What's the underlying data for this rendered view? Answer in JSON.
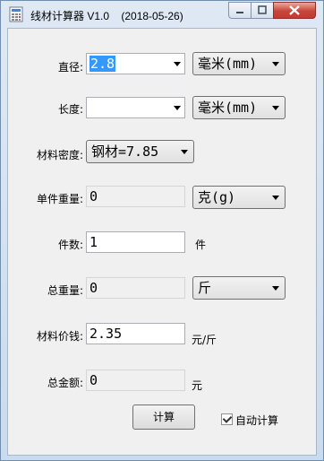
{
  "window": {
    "title": "线材计算器 V1.0    (2018-05-26)"
  },
  "form": {
    "diameter": {
      "label": "直径:",
      "value": "2.8",
      "unit": "毫米(mm)"
    },
    "length": {
      "label": "长度:",
      "value": "",
      "unit": "毫米(mm)"
    },
    "density": {
      "label": "材料密度:",
      "value": "钢材=7.85"
    },
    "unit_weight": {
      "label": "单件重量:",
      "value": "0",
      "unit": "克(g)"
    },
    "count": {
      "label": "件数:",
      "value": "1",
      "unit": "件"
    },
    "total_weight": {
      "label": "总重量:",
      "value": "0",
      "unit": "斤"
    },
    "price": {
      "label": "材料价钱:",
      "value": "2.35",
      "unit": "元/斤"
    },
    "total_amount": {
      "label": "总金额:",
      "value": "0",
      "unit": "元"
    }
  },
  "actions": {
    "calc_label": "计算",
    "auto_calc_label": "自动计算",
    "auto_calc_checked": true
  }
}
